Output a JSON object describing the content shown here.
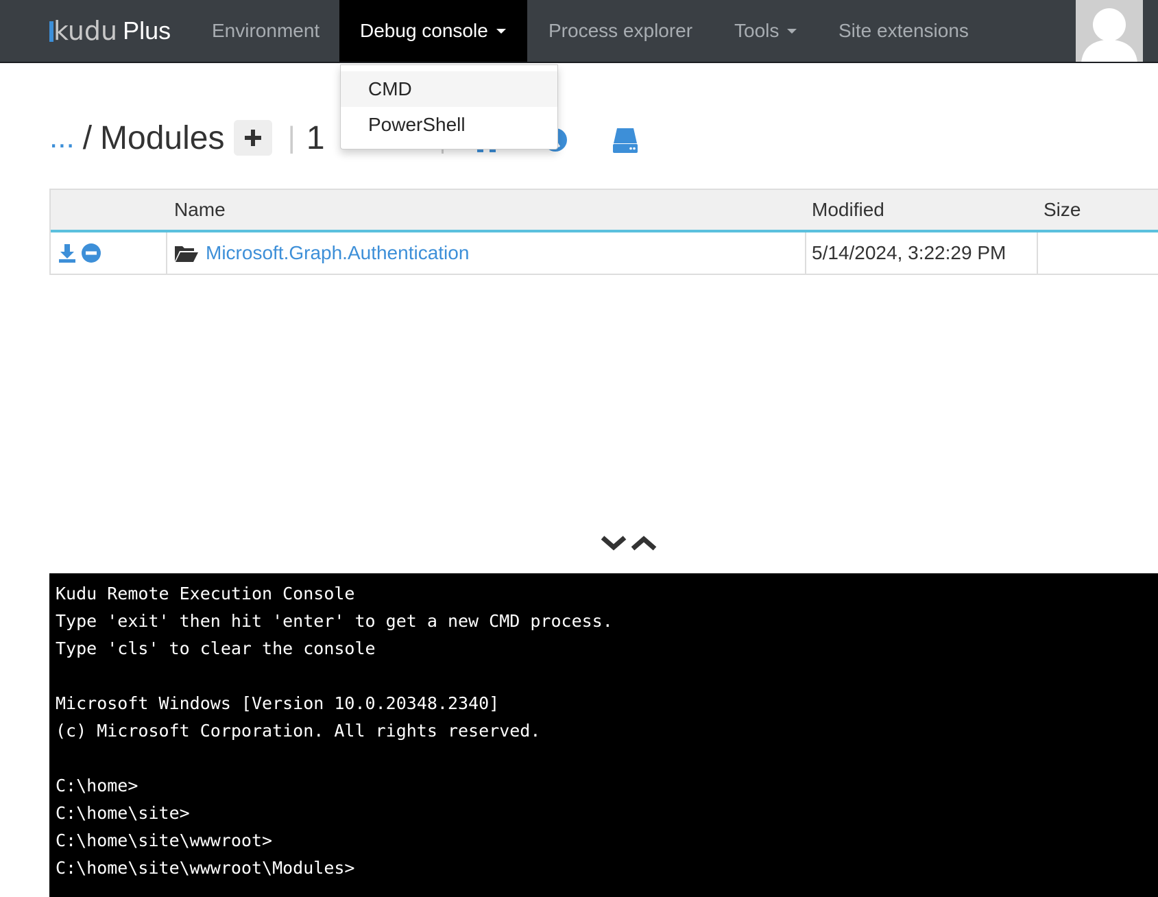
{
  "brand": {
    "logo_text": "udu",
    "plus_label": "Plus"
  },
  "nav": {
    "items": [
      {
        "label": "Environment"
      },
      {
        "label": "Debug console"
      },
      {
        "label": "Process explorer"
      },
      {
        "label": "Tools"
      },
      {
        "label": "Site extensions"
      }
    ],
    "active": "Debug console"
  },
  "dropdown": {
    "items": [
      {
        "label": "CMD"
      },
      {
        "label": "PowerShell"
      }
    ]
  },
  "breadcrumb": {
    "ellipsis": "...",
    "separator": "/",
    "current": "Modules",
    "count": "1"
  },
  "table": {
    "headers": {
      "name": "Name",
      "modified": "Modified",
      "size": "Size"
    },
    "rows": [
      {
        "name": "Microsoft.Graph.Authentication",
        "modified": "5/14/2024, 3:22:29 PM",
        "size": ""
      }
    ]
  },
  "console": {
    "lines": [
      "Kudu Remote Execution Console",
      "Type 'exit' then hit 'enter' to get a new CMD process.",
      "Type 'cls' to clear the console",
      "",
      "Microsoft Windows [Version 10.0.20348.2340]",
      "(c) Microsoft Corporation. All rights reserved.",
      "",
      "C:\\home>",
      "C:\\home\\site>",
      "C:\\home\\site\\wwwroot>",
      "C:\\home\\site\\wwwroot\\Modules>"
    ]
  },
  "colors": {
    "accent": "#3d8fd8",
    "navbar": "#3a3f44",
    "active_nav": "#000000",
    "table_rule": "#5bc0de"
  }
}
